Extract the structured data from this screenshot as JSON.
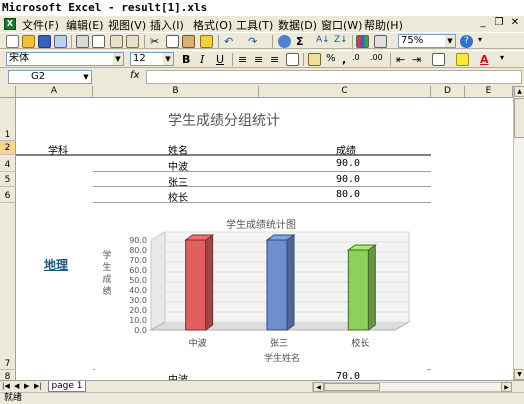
{
  "window": {
    "title": "Microsoft Excel - result[1].xls"
  },
  "menu": {
    "items": [
      "文件(F)",
      "编辑(E)",
      "视图(V)",
      "插入(I)",
      "格式(O)",
      "工具(T)",
      "数据(D)",
      "窗口(W)",
      "帮助(H)"
    ]
  },
  "toolbar": {
    "zoom": "75%",
    "font_name": "宋体",
    "font_size": "12",
    "bold": "B",
    "italic": "I",
    "underline": "U"
  },
  "formula_bar": {
    "cell_ref": "G2",
    "fx": "fx",
    "value": ""
  },
  "columns": [
    "A",
    "B",
    "C",
    "D",
    "E"
  ],
  "rows": [
    "1",
    "2",
    "4",
    "5",
    "6",
    "7",
    "8"
  ],
  "sheet": {
    "title": "学生成绩分组统计",
    "headers": {
      "subject": "学科",
      "name": "姓名",
      "score": "成绩"
    },
    "group": {
      "subject": "地理",
      "rows": [
        {
          "name": "中波",
          "score": "90.0"
        },
        {
          "name": "张三",
          "score": "90.0"
        },
        {
          "name": "校长",
          "score": "80.0"
        }
      ]
    },
    "next_row": {
      "name": "中波",
      "score": "70.0"
    }
  },
  "chart_data": {
    "type": "bar",
    "title": "学生成绩统计图",
    "xlabel": "学生姓名",
    "ylabel": "学生成绩",
    "categories": [
      "中波",
      "张三",
      "校长"
    ],
    "values": [
      90,
      90,
      80
    ],
    "colors": [
      "#e06060",
      "#6d8fd0",
      "#8fd05a"
    ],
    "ylim": [
      0,
      90
    ],
    "yticks": [
      "0.0",
      "10.0",
      "20.0",
      "30.0",
      "40.0",
      "50.0",
      "60.0",
      "70.0",
      "80.0",
      "90.0"
    ]
  },
  "tabs": {
    "sheets": [
      "page 1"
    ]
  },
  "status": {
    "text": "就绪"
  }
}
